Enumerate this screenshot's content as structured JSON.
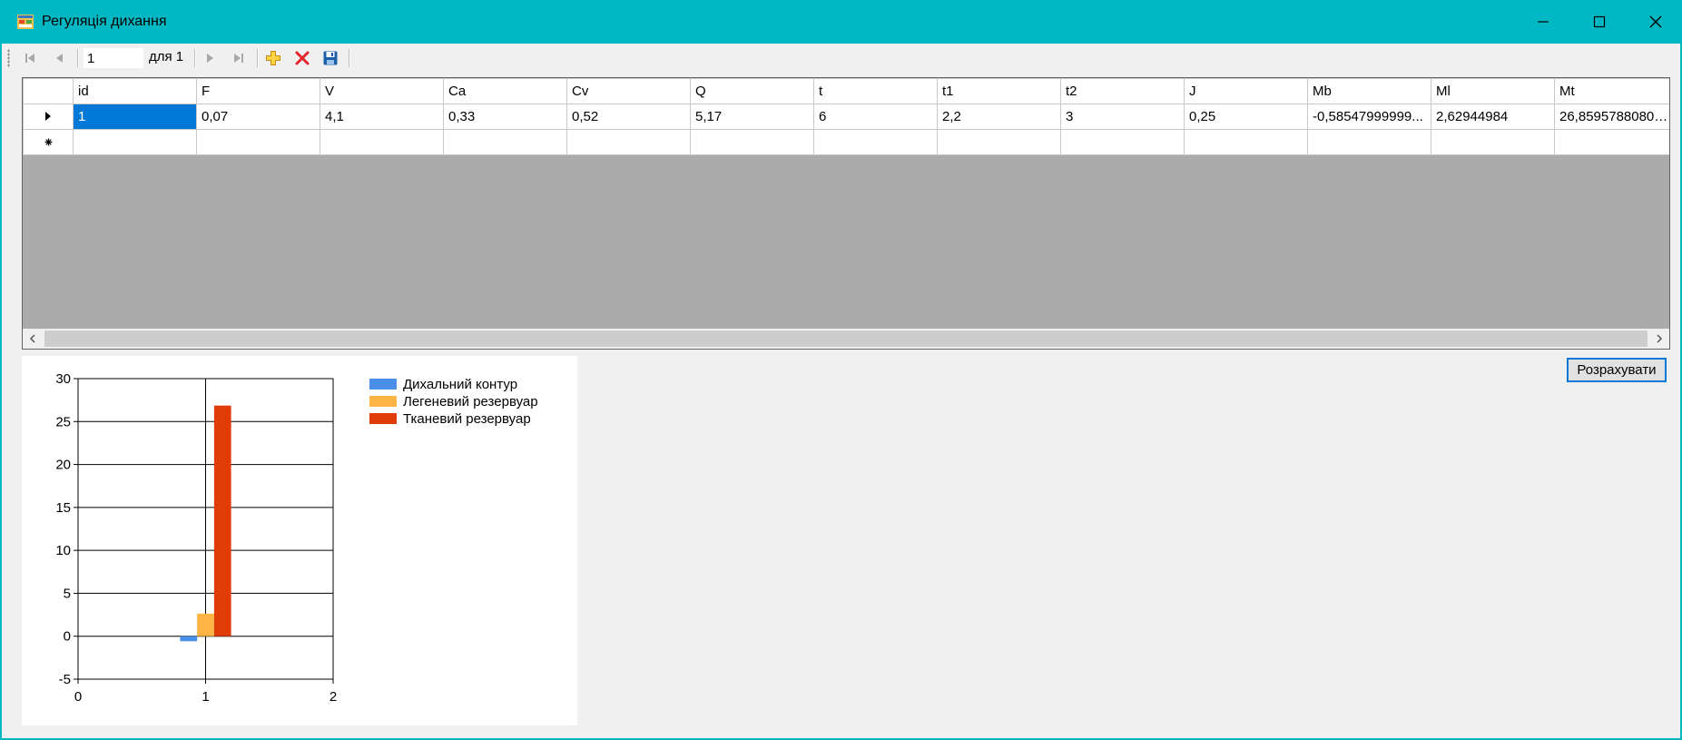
{
  "window": {
    "title": "Регуляція дихання",
    "accent": "#00b7c3"
  },
  "navigator": {
    "position": "1",
    "of_label": "для 1"
  },
  "grid": {
    "columns": [
      "id",
      "F",
      "V",
      "Ca",
      "Cv",
      "Q",
      "t",
      "t1",
      "t2",
      "J",
      "Mb",
      "Ml",
      "Mt"
    ],
    "rows": [
      [
        "1",
        "0,07",
        "4,1",
        "0,33",
        "0,52",
        "5,17",
        "6",
        "2,2",
        "3",
        "0,25",
        "-0,58547999999...",
        "2,62944984",
        "26,85957880800..."
      ]
    ]
  },
  "calculate_button": "Розрахувати",
  "chart_data": {
    "type": "bar",
    "x_ticks": [
      "0",
      "1",
      "2"
    ],
    "y_ticks": [
      "-5",
      "0",
      "5",
      "10",
      "15",
      "20",
      "25",
      "30"
    ],
    "xlim": [
      0,
      2
    ],
    "ylim": [
      -5,
      30
    ],
    "grid": true,
    "legend_position": "top-right",
    "x": 1,
    "series": [
      {
        "name": "Дихальний контур",
        "value": -0.58548,
        "color": "#4a90e8"
      },
      {
        "name": "Легеневий резервуар",
        "value": 2.62945,
        "color": "#ffb443"
      },
      {
        "name": "Тканевий резервуар",
        "value": 26.85958,
        "color": "#e03c08"
      }
    ]
  }
}
